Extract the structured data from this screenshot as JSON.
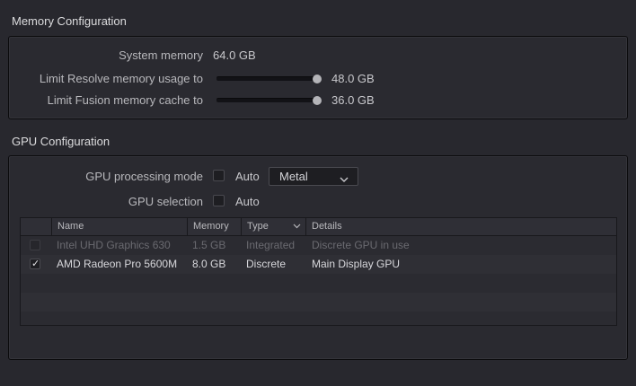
{
  "memory": {
    "title": "Memory Configuration",
    "system_memory_label": "System memory",
    "system_memory_value": "64.0 GB",
    "resolve_limit_label": "Limit Resolve memory usage to",
    "resolve_limit_value": "48.0 GB",
    "resolve_limit_fraction": 1.0,
    "fusion_cache_label": "Limit Fusion memory cache to",
    "fusion_cache_value": "36.0 GB",
    "fusion_cache_fraction": 1.0
  },
  "gpu": {
    "title": "GPU Configuration",
    "processing_mode_label": "GPU processing mode",
    "processing_mode_auto_label": "Auto",
    "processing_mode_auto_checked": false,
    "processing_mode_selected": "Metal",
    "selection_label": "GPU selection",
    "selection_auto_label": "Auto",
    "selection_auto_checked": false,
    "table": {
      "headers": [
        "",
        "Name",
        "Memory",
        "Type",
        "Details"
      ],
      "type_sort_icon": "chevron-down-icon",
      "rows": [
        {
          "checked": false,
          "enabled": false,
          "name": "Intel UHD Graphics 630",
          "memory": "1.5 GB",
          "type": "Integrated",
          "details": "Discrete GPU in use"
        },
        {
          "checked": true,
          "enabled": true,
          "name": "AMD Radeon Pro 5600M",
          "memory": "8.0 GB",
          "type": "Discrete",
          "details": "Main Display GPU"
        }
      ]
    }
  },
  "colors": {
    "background": "#28282e",
    "panel_border": "#0b0b0d",
    "text": "#c8c8cc",
    "disabled_text": "#6a6a70"
  }
}
